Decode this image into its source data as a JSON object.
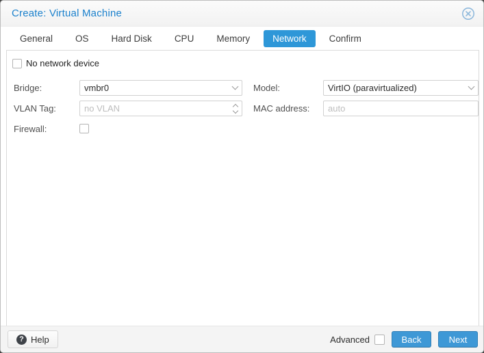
{
  "window": {
    "title": "Create: Virtual Machine",
    "close_icon": "circle-x-icon"
  },
  "tabs": [
    {
      "label": "General",
      "active": false
    },
    {
      "label": "OS",
      "active": false
    },
    {
      "label": "Hard Disk",
      "active": false
    },
    {
      "label": "CPU",
      "active": false
    },
    {
      "label": "Memory",
      "active": false
    },
    {
      "label": "Network",
      "active": true
    },
    {
      "label": "Confirm",
      "active": false
    }
  ],
  "form": {
    "no_network_device": {
      "label": "No network device",
      "checked": false
    },
    "bridge": {
      "label": "Bridge:",
      "value": "vmbr0",
      "type": "combo"
    },
    "model": {
      "label": "Model:",
      "value": "VirtIO (paravirtualized)",
      "type": "combo"
    },
    "vlan": {
      "label": "VLAN Tag:",
      "placeholder": "no VLAN",
      "type": "spinner"
    },
    "mac": {
      "label": "MAC address:",
      "placeholder": "auto",
      "type": "text"
    },
    "firewall": {
      "label": "Firewall:",
      "checked": false
    }
  },
  "footer": {
    "help_label": "Help",
    "advanced_label": "Advanced",
    "advanced_checked": false,
    "back_label": "Back",
    "next_label": "Next"
  },
  "colors": {
    "accent_blue": "#2e97d8",
    "title_blue": "#1a80cc",
    "button_blue": "#3e98d6",
    "placeholder_gray": "#bdbdbd"
  }
}
